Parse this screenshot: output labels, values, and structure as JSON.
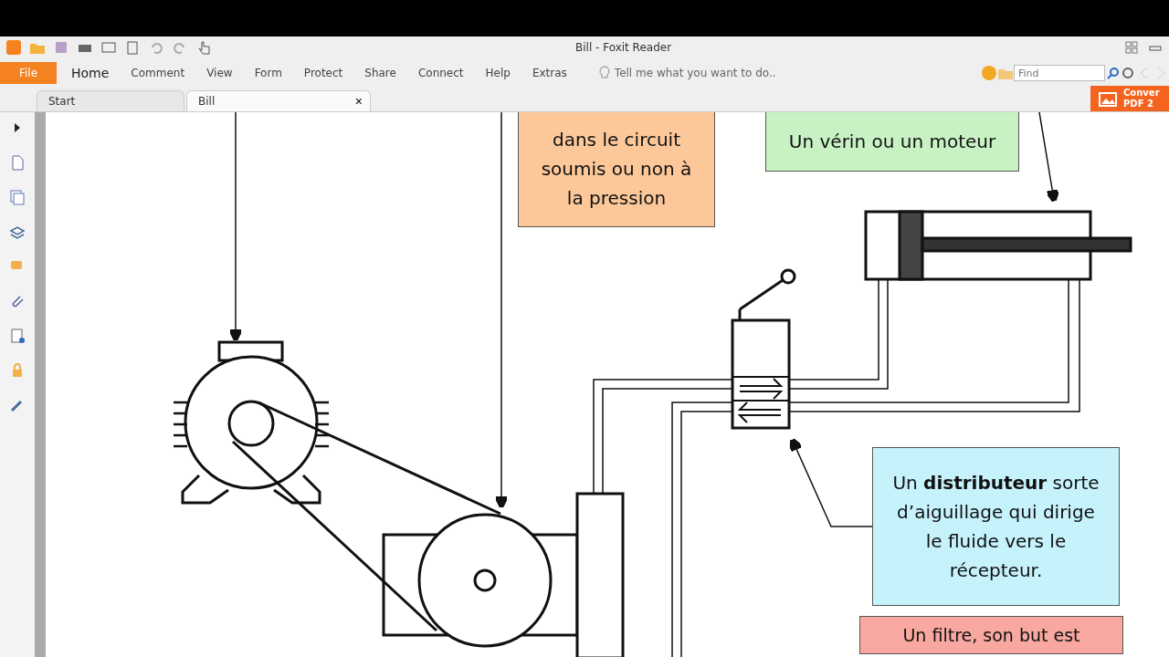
{
  "window": {
    "title": "Bill - Foxit Reader"
  },
  "menu": {
    "file": "File",
    "items": [
      {
        "label": "Home",
        "selected": true
      },
      {
        "label": "Comment",
        "selected": false
      },
      {
        "label": "View",
        "selected": false
      },
      {
        "label": "Form",
        "selected": false
      },
      {
        "label": "Protect",
        "selected": false
      },
      {
        "label": "Share",
        "selected": false
      },
      {
        "label": "Connect",
        "selected": false
      },
      {
        "label": "Help",
        "selected": false
      },
      {
        "label": "Extras",
        "selected": false
      }
    ],
    "tell_me": {
      "placeholder": "Tell me what you want to do.."
    },
    "find": {
      "placeholder": "Find"
    }
  },
  "tabs": [
    {
      "label": "Start",
      "selected": false
    },
    {
      "label": "Bill",
      "selected": true,
      "close": "×"
    }
  ],
  "convert_button": {
    "lines": [
      "Conver",
      "PDF 2"
    ]
  },
  "callouts": [
    {
      "lines": [
        "dans le circuit",
        "soumis ou non à",
        "la pression"
      ],
      "color": "#fcc89a"
    },
    {
      "lines": [
        "Un vérin ou un moteur"
      ],
      "color": "#c8f2c4"
    },
    {
      "lines": [
        "Un **distributeur** sorte",
        "d’aiguillage qui dirige",
        "le fluide vers le",
        "récepteur."
      ],
      "color": "#c6f2fc"
    },
    {
      "lines": [
        "Un filtre, son but est"
      ],
      "color": "#f8a8a0"
    }
  ]
}
